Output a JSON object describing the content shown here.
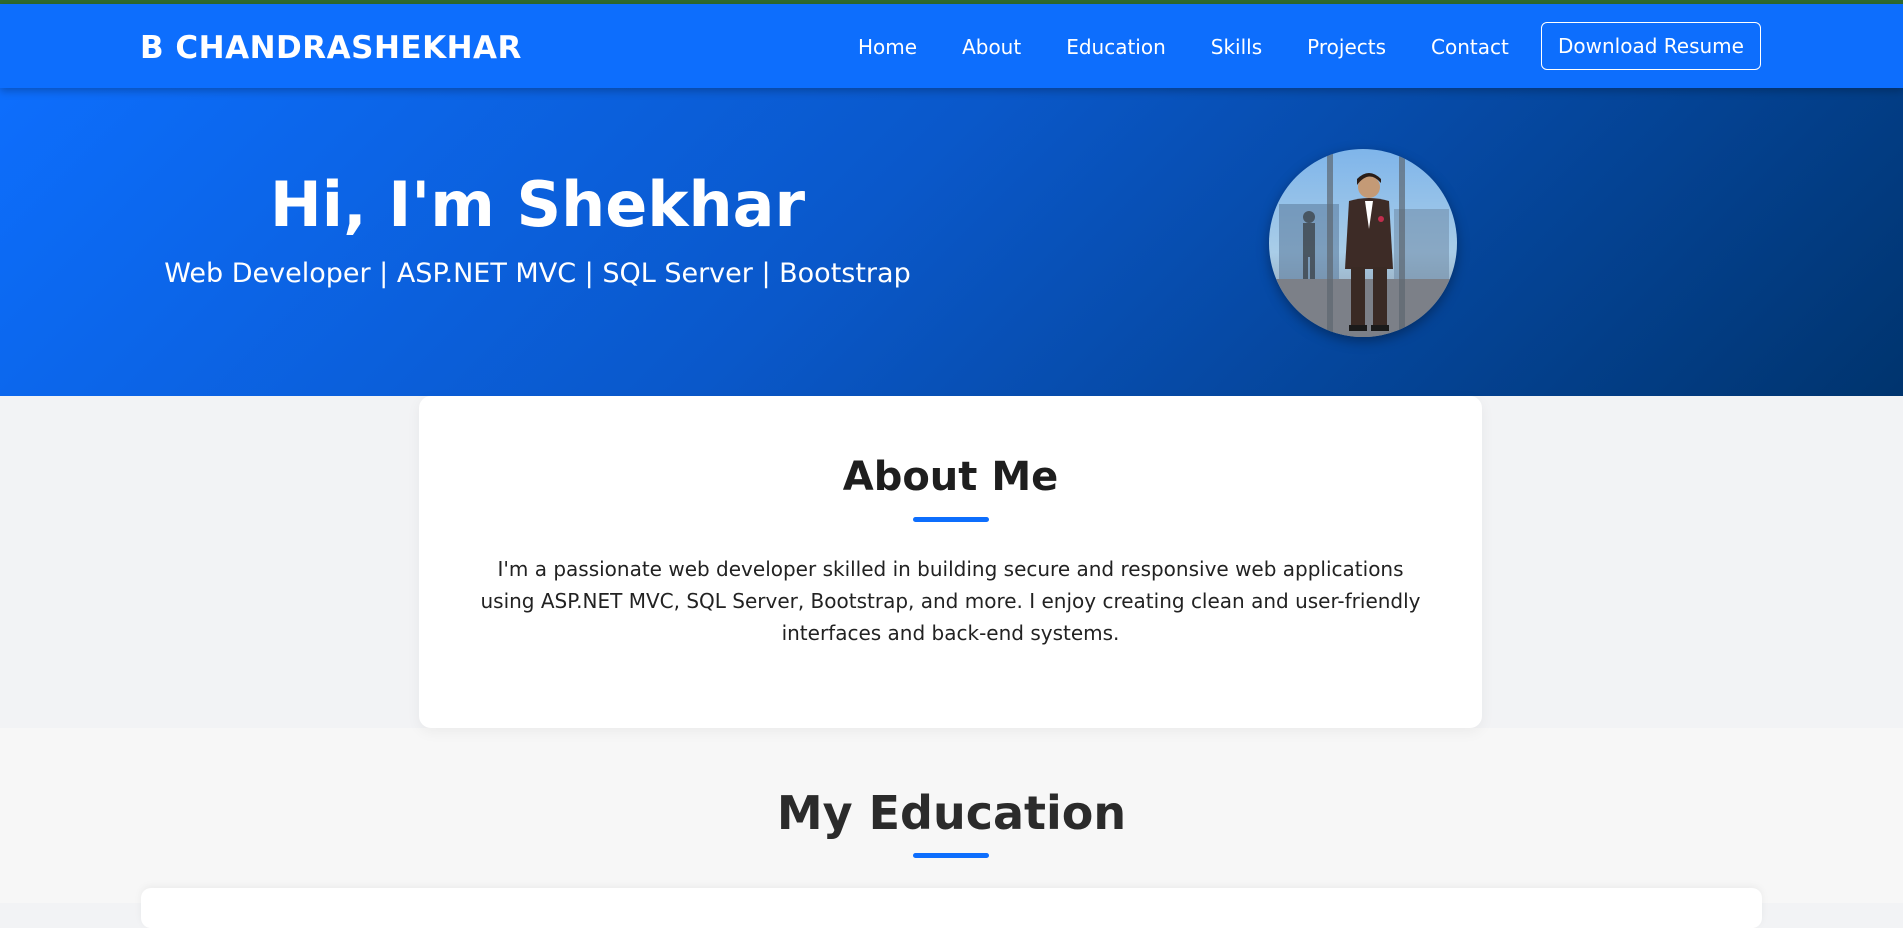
{
  "navbar": {
    "brand": "B CHANDRASHEKHAR",
    "links": [
      "Home",
      "About",
      "Education",
      "Skills",
      "Projects",
      "Contact"
    ],
    "resume_button": "Download Resume"
  },
  "hero": {
    "title": "Hi, I'm Shekhar",
    "subtitle": "Web Developer | ASP.NET MVC | SQL Server | Bootstrap"
  },
  "about": {
    "title": "About Me",
    "text": "I'm a passionate web developer skilled in building secure and responsive web applications using ASP.NET MVC, SQL Server, Bootstrap, and more. I enjoy creating clean and user-friendly interfaces and back-end systems."
  },
  "education": {
    "title": "My Education"
  },
  "colors": {
    "primary": "#0d6efd",
    "hero_dark": "#00346e",
    "background": "#f2f3f5"
  }
}
